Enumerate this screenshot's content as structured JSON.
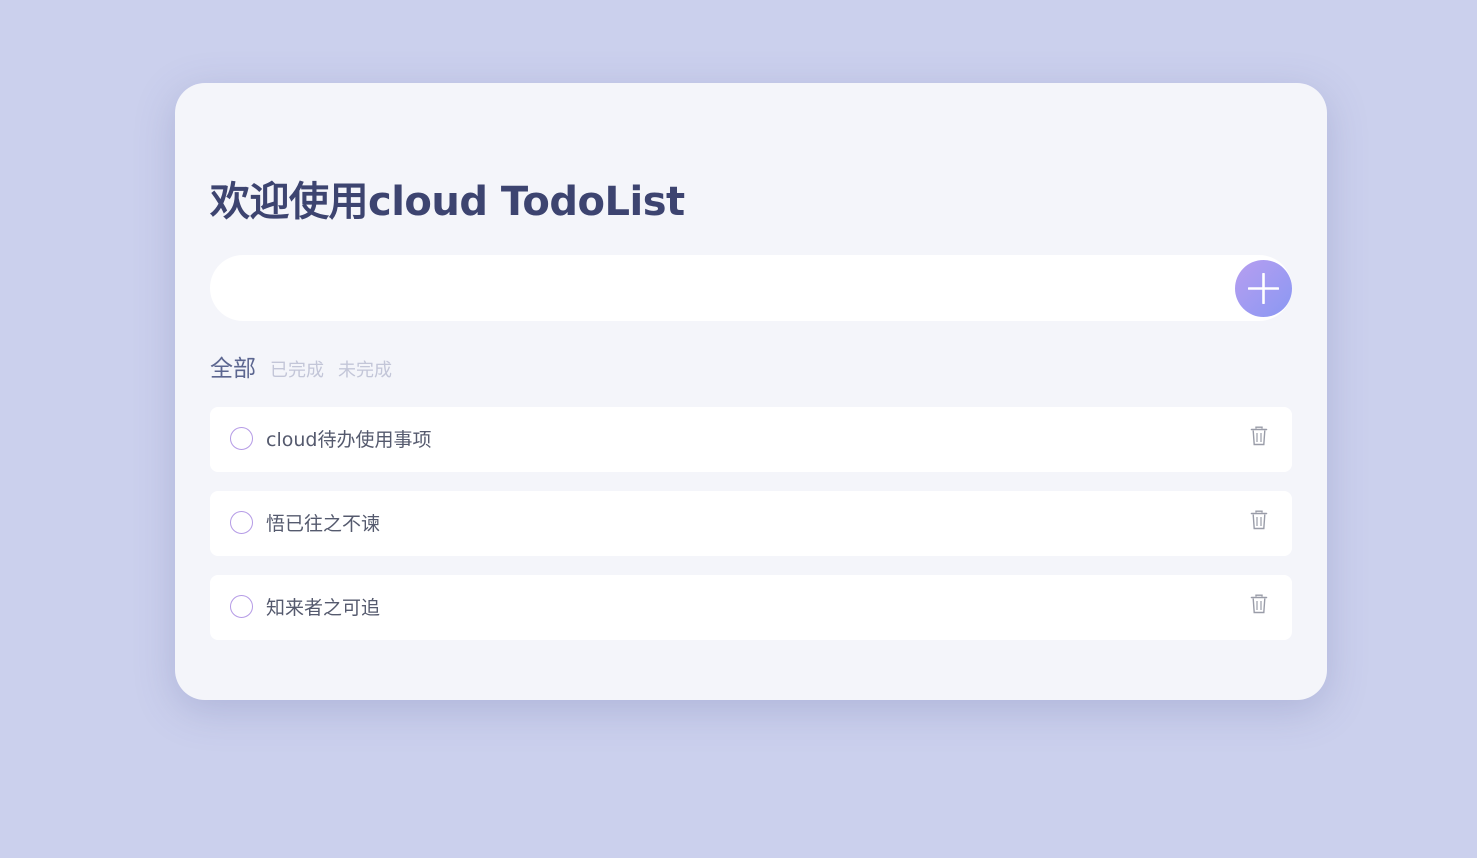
{
  "app": {
    "title": "欢迎使用cloud TodoList"
  },
  "input": {
    "value": "",
    "placeholder": ""
  },
  "add_button": {
    "icon": "plus-icon"
  },
  "filters": {
    "tabs": [
      {
        "label": "全部",
        "active": true
      },
      {
        "label": "已完成",
        "active": false
      },
      {
        "label": "未完成",
        "active": false
      }
    ]
  },
  "todos": [
    {
      "text": "cloud待办使用事项",
      "done": false,
      "delete_icon": "trash-icon"
    },
    {
      "text": "悟已往之不谏",
      "done": false,
      "delete_icon": "trash-icon"
    },
    {
      "text": "知来者之可追",
      "done": false,
      "delete_icon": "trash-icon"
    }
  ],
  "colors": {
    "background": "#cbd0ed",
    "card": "#f4f5fa",
    "title": "#3d4470",
    "accent_start": "#b79ef0",
    "accent_end": "#8a98f3",
    "active_tab": "#5c6690",
    "inactive_tab": "#c3c6d8",
    "checkbox_border": "#b59be6"
  }
}
